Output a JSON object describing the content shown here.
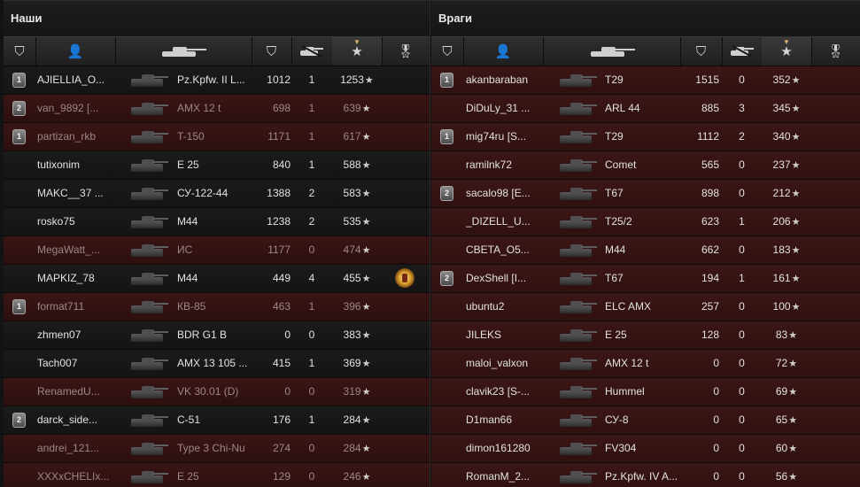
{
  "teams": {
    "ours": {
      "title": "Наши",
      "players": [
        {
          "name": "AJIELLIA_O...",
          "vehicle": "Pz.Kpfw. II L...",
          "damage": "1012",
          "kills": "1",
          "xp": "1253",
          "badge": "1",
          "alive": true,
          "medal": false
        },
        {
          "name": "van_9892 [...",
          "vehicle": "AMX 12 t",
          "damage": "698",
          "kills": "1",
          "xp": "639",
          "badge": "2",
          "alive": false,
          "medal": false
        },
        {
          "name": "partizan_rkb",
          "vehicle": "T-150",
          "damage": "1171",
          "kills": "1",
          "xp": "617",
          "badge": "1",
          "alive": false,
          "medal": false
        },
        {
          "name": "tutixonim",
          "vehicle": "E 25",
          "damage": "840",
          "kills": "1",
          "xp": "588",
          "badge": "",
          "alive": true,
          "medal": false
        },
        {
          "name": "MAKC__37 ...",
          "vehicle": "СУ-122-44",
          "damage": "1388",
          "kills": "2",
          "xp": "583",
          "badge": "",
          "alive": true,
          "medal": false
        },
        {
          "name": "rosko75",
          "vehicle": "M44",
          "damage": "1238",
          "kills": "2",
          "xp": "535",
          "badge": "",
          "alive": true,
          "medal": false
        },
        {
          "name": "MegaWatt_...",
          "vehicle": "ИС",
          "damage": "1177",
          "kills": "0",
          "xp": "474",
          "badge": "",
          "alive": false,
          "medal": false
        },
        {
          "name": "MAPKIZ_78",
          "vehicle": "M44",
          "damage": "449",
          "kills": "4",
          "xp": "455",
          "badge": "",
          "alive": true,
          "medal": true
        },
        {
          "name": "format711",
          "vehicle": "КВ-85",
          "damage": "463",
          "kills": "1",
          "xp": "396",
          "badge": "1",
          "alive": false,
          "medal": false
        },
        {
          "name": "zhmen07",
          "vehicle": "BDR G1 B",
          "damage": "0",
          "kills": "0",
          "xp": "383",
          "badge": "",
          "alive": true,
          "medal": false
        },
        {
          "name": "Tach007",
          "vehicle": "AMX 13 105 ...",
          "damage": "415",
          "kills": "1",
          "xp": "369",
          "badge": "",
          "alive": true,
          "medal": false
        },
        {
          "name": "RenamedU...",
          "vehicle": "VK 30.01 (D)",
          "damage": "0",
          "kills": "0",
          "xp": "319",
          "badge": "",
          "alive": false,
          "medal": false
        },
        {
          "name": "darck_side...",
          "vehicle": "С-51",
          "damage": "176",
          "kills": "1",
          "xp": "284",
          "badge": "2",
          "alive": true,
          "medal": false
        },
        {
          "name": "andrei_121...",
          "vehicle": "Type 3 Chi-Nu",
          "damage": "274",
          "kills": "0",
          "xp": "284",
          "badge": "",
          "alive": false,
          "medal": false
        },
        {
          "name": "XXXxCHELIx...",
          "vehicle": "E 25",
          "damage": "129",
          "kills": "0",
          "xp": "246",
          "badge": "",
          "alive": false,
          "medal": false
        }
      ]
    },
    "enemy": {
      "title": "Враги",
      "players": [
        {
          "name": "akanbaraban",
          "vehicle": "T29",
          "damage": "1515",
          "kills": "0",
          "xp": "352",
          "badge": "1",
          "alive": true
        },
        {
          "name": "DiDuLy_31 ...",
          "vehicle": "ARL 44",
          "damage": "885",
          "kills": "3",
          "xp": "345",
          "badge": "",
          "alive": true
        },
        {
          "name": "mig74ru [S...",
          "vehicle": "T29",
          "damage": "1112",
          "kills": "2",
          "xp": "340",
          "badge": "1",
          "alive": true
        },
        {
          "name": "ramilnk72",
          "vehicle": "Comet",
          "damage": "565",
          "kills": "0",
          "xp": "237",
          "badge": "",
          "alive": true
        },
        {
          "name": "sacalo98 [E...",
          "vehicle": "T67",
          "damage": "898",
          "kills": "0",
          "xp": "212",
          "badge": "2",
          "alive": true
        },
        {
          "name": "_DIZELL_U...",
          "vehicle": "T25/2",
          "damage": "623",
          "kills": "1",
          "xp": "206",
          "badge": "",
          "alive": true
        },
        {
          "name": "CBETA_O5...",
          "vehicle": "M44",
          "damage": "662",
          "kills": "0",
          "xp": "183",
          "badge": "",
          "alive": true
        },
        {
          "name": "DexShell [I...",
          "vehicle": "T67",
          "damage": "194",
          "kills": "1",
          "xp": "161",
          "badge": "2",
          "alive": true
        },
        {
          "name": "ubuntu2",
          "vehicle": "ELC AMX",
          "damage": "257",
          "kills": "0",
          "xp": "100",
          "badge": "",
          "alive": true
        },
        {
          "name": "JILEKS",
          "vehicle": "E 25",
          "damage": "128",
          "kills": "0",
          "xp": "83",
          "badge": "",
          "alive": true
        },
        {
          "name": "maloi_valxon",
          "vehicle": "AMX 12 t",
          "damage": "0",
          "kills": "0",
          "xp": "72",
          "badge": "",
          "alive": true
        },
        {
          "name": "clavik23 [S-...",
          "vehicle": "Hummel",
          "damage": "0",
          "kills": "0",
          "xp": "69",
          "badge": "",
          "alive": true
        },
        {
          "name": "D1man66",
          "vehicle": "СУ-8",
          "damage": "0",
          "kills": "0",
          "xp": "65",
          "badge": "",
          "alive": true
        },
        {
          "name": "dimon161280",
          "vehicle": "FV304",
          "damage": "0",
          "kills": "0",
          "xp": "60",
          "badge": "",
          "alive": true
        },
        {
          "name": "RomanM_2...",
          "vehicle": "Pz.Kpfw. IV A...",
          "damage": "0",
          "kills": "0",
          "xp": "56",
          "badge": "",
          "alive": true
        }
      ]
    }
  },
  "icons": {
    "rank": "rank-icon",
    "player": "player-icon",
    "vehicle": "tank-icon",
    "damage": "damage-icon",
    "kills": "kills-icon",
    "xp": "star-icon",
    "medal": "medal-icon",
    "sort": "sort-arrow-icon"
  },
  "colors": {
    "alive_row": "#1a1a1a",
    "dead_row": "#3a1515",
    "enemy_row": "#3c1616",
    "text": "#e2e2e2",
    "sort_accent": "#d9b56a"
  }
}
